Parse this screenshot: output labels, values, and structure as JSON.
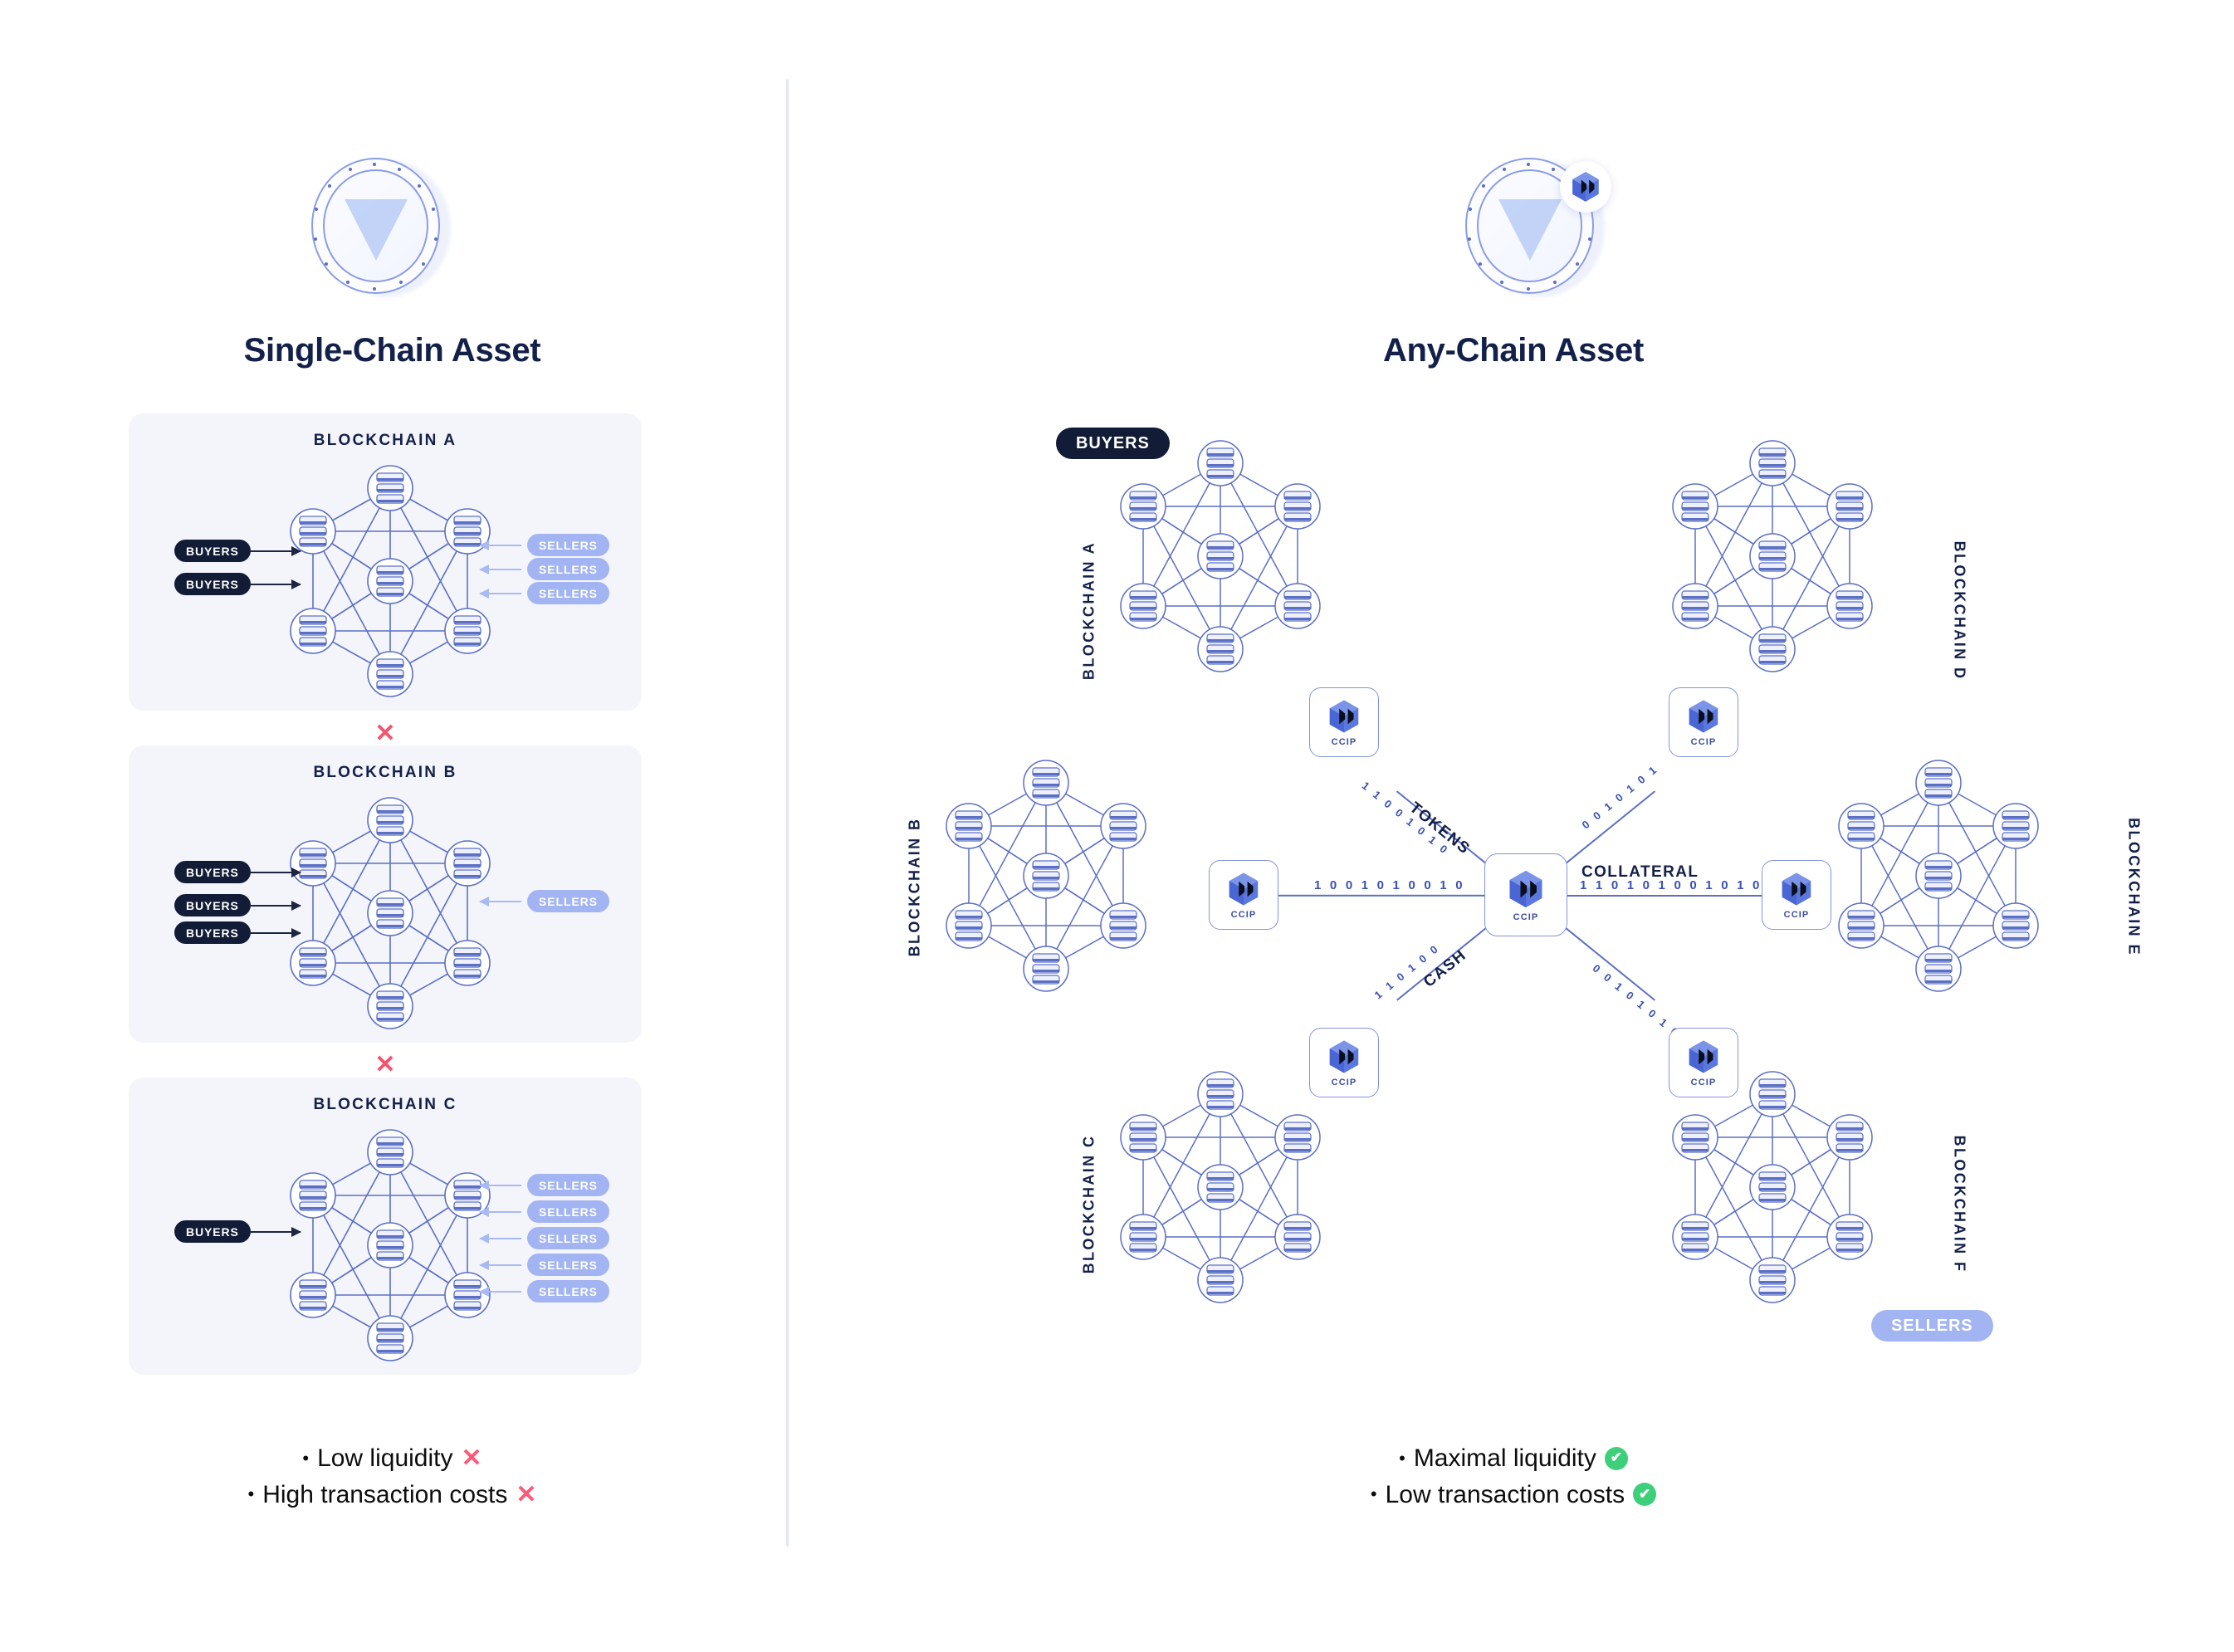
{
  "left": {
    "title": "Single-Chain Asset",
    "coin_icon": "coin-token-icon",
    "cards": [
      {
        "title": "BLOCKCHAIN A",
        "buyers": [
          "BUYERS",
          "BUYERS"
        ],
        "sellers": [
          "SELLERS",
          "SELLERS",
          "SELLERS"
        ]
      },
      {
        "title": "BLOCKCHAIN B",
        "buyers": [
          "BUYERS",
          "BUYERS",
          "BUYERS"
        ],
        "sellers": [
          "SELLERS"
        ]
      },
      {
        "title": "BLOCKCHAIN C",
        "buyers": [
          "BUYERS"
        ],
        "sellers": [
          "SELLERS",
          "SELLERS",
          "SELLERS",
          "SELLERS",
          "SELLERS"
        ]
      }
    ],
    "separators": [
      "✕",
      "✕"
    ],
    "bullets": [
      {
        "dot": "•",
        "text": "Low liquidity",
        "mark": "✕",
        "mark_type": "x"
      },
      {
        "dot": "•",
        "text": "High transaction costs",
        "mark": "✕",
        "mark_type": "x"
      }
    ]
  },
  "right": {
    "title": "Any-Chain Asset",
    "coin_icon": "coin-token-icon",
    "coin_badge_icon": "ccip-logo-icon",
    "buyers_badge": "BUYERS",
    "sellers_badge": "SELLERS",
    "hub": {
      "label": "CCIP",
      "icon": "ccip-logo-icon"
    },
    "chains": [
      {
        "label": "BLOCKCHAIN A",
        "ccip_label": "CCIP"
      },
      {
        "label": "BLOCKCHAIN B",
        "ccip_label": "CCIP"
      },
      {
        "label": "BLOCKCHAIN C",
        "ccip_label": "CCIP"
      },
      {
        "label": "BLOCKCHAIN D",
        "ccip_label": "CCIP"
      },
      {
        "label": "BLOCKCHAIN E",
        "ccip_label": "CCIP"
      },
      {
        "label": "BLOCKCHAIN F",
        "ccip_label": "CCIP"
      }
    ],
    "spokes": [
      {
        "name": "tokens",
        "label": "TOKENS",
        "binary": "1 1 0 0 1 0 1 0"
      },
      {
        "name": "collateral",
        "label": "COLLATERAL",
        "binary": "1 1 0 1 0 1 0 0 1 0 1 0"
      },
      {
        "name": "cash",
        "label": "CASH",
        "binary": "1 1 0 1 0 0"
      },
      {
        "name": "upper-right",
        "label": "",
        "binary": "0 0 1 0 1 0 1"
      },
      {
        "name": "left",
        "label": "",
        "binary": "1 0 0 1 0 1 0 0 1 0"
      },
      {
        "name": "lower-right",
        "label": "",
        "binary": "0 0 1 0 1 0 1 0"
      }
    ],
    "bullets": [
      {
        "dot": "•",
        "text": "Maximal liquidity",
        "mark": "✔",
        "mark_type": "check"
      },
      {
        "dot": "•",
        "text": "Low transaction costs",
        "mark": "✔",
        "mark_type": "check"
      }
    ]
  },
  "colors": {
    "ink": "#132049",
    "node_blue": "#5b6fc4",
    "pill_dark": "#121c36",
    "pill_light": "#a3b4f2",
    "card_bg": "#f4f5fb",
    "x_red": "#fa5a78",
    "check_green": "#3ecf7a",
    "divider": "#e3e4f6"
  }
}
